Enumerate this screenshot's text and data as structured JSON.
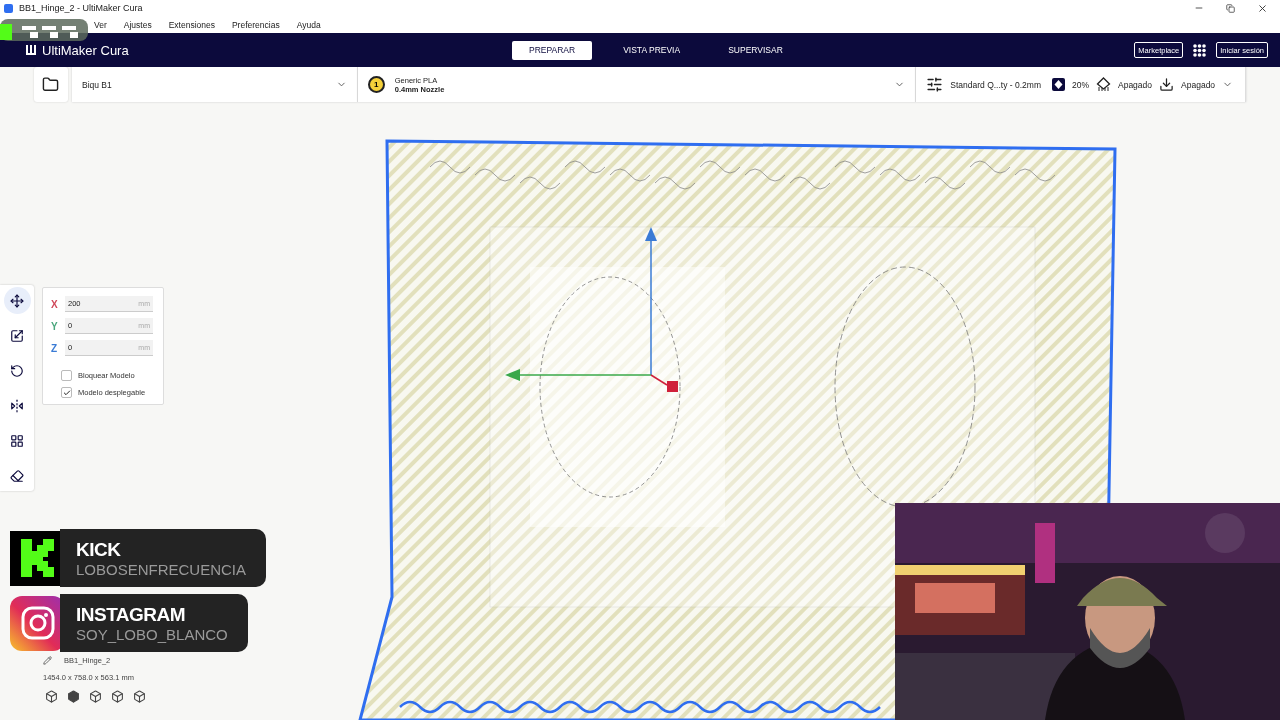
{
  "window": {
    "title": "BB1_Hinge_2 - UltiMaker Cura"
  },
  "menu": [
    "Ver",
    "Ajustes",
    "Extensiones",
    "Preferencias",
    "Ayuda"
  ],
  "header": {
    "logo": "UltiMaker Cura",
    "stages": [
      {
        "label": "PREPARAR",
        "selected": true
      },
      {
        "label": "VISTA PREVIA",
        "selected": false
      },
      {
        "label": "SUPERVISAR",
        "selected": false
      }
    ],
    "marketplace": "Marketplace",
    "sign_in": "Iniciar sesión"
  },
  "toolbar": {
    "printer": "Biqu B1",
    "extruder": "1",
    "material": "Generic PLA",
    "nozzle": "0.4mm Nozzle",
    "profile": "Standard Q...ty - 0.2mm",
    "infill": "20%",
    "support": "Apagado",
    "adhesion": "Apagado"
  },
  "tools": [
    {
      "kind": "move",
      "selected": true
    },
    {
      "kind": "scale",
      "selected": false
    },
    {
      "kind": "rotate",
      "selected": false
    },
    {
      "kind": "mirror",
      "selected": false
    },
    {
      "kind": "per_model",
      "selected": false
    },
    {
      "kind": "support_blocker",
      "selected": false
    }
  ],
  "move_panel": {
    "fields": [
      {
        "axis": "X",
        "value": "200",
        "unit": "mm",
        "color": "#d0485a"
      },
      {
        "axis": "Y",
        "value": "0",
        "unit": "mm",
        "color": "#4aa67c"
      },
      {
        "axis": "Z",
        "value": "0",
        "unit": "mm",
        "color": "#3a7bd5"
      }
    ],
    "checkboxes": [
      {
        "label": "Bloquear Modelo",
        "checked": false
      },
      {
        "label": "Modelo desplegable",
        "checked": true
      }
    ]
  },
  "socials": [
    {
      "kind": "kick",
      "title": "KICK",
      "handle": "LOBOSENFRECUENCIA"
    },
    {
      "kind": "instagram",
      "title": "INSTAGRAM",
      "handle": "SOY_LOBO_BLANCO"
    }
  ],
  "object_info": {
    "name": "BB1_Hinge_2",
    "dimensions": "1454.0 x 758.0 x 563.1 mm"
  },
  "webcam": {
    "kind": "picture"
  }
}
